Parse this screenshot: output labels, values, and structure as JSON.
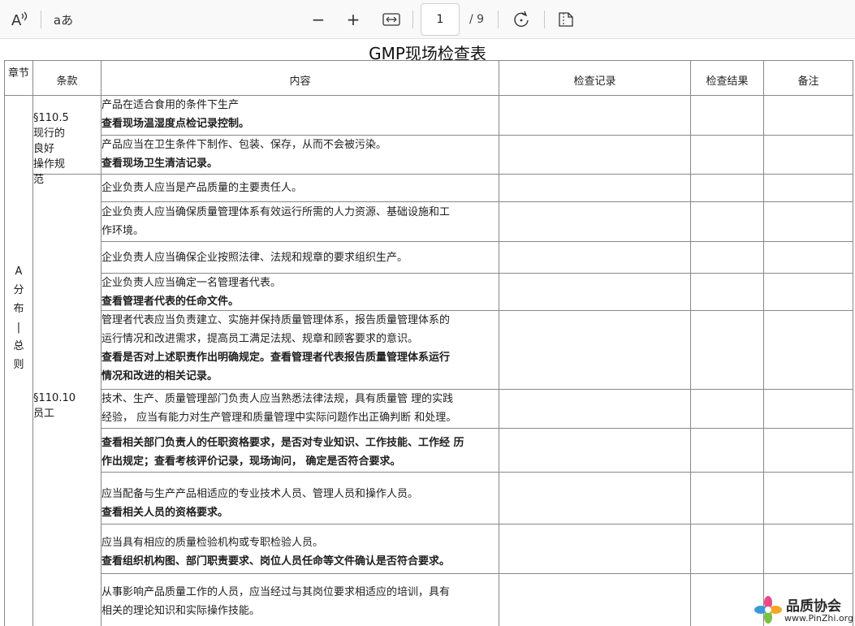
{
  "toolbar": {
    "read_aloud_glyph": "A",
    "text_options_glyph": "aあ",
    "zoom_out": "−",
    "zoom_in": "+",
    "page_current": "1",
    "page_total": "/ 9"
  },
  "document": {
    "title": "GMP现场检查表",
    "headers": {
      "chapter": "章节",
      "clause": "条款",
      "content": "内容",
      "record": "检查记录",
      "result": "检查结果",
      "remark": "备注"
    },
    "chapter_label": [
      "A",
      "分",
      "布",
      "|",
      "总",
      "则"
    ],
    "clauses": {
      "c1": [
        "§110.5",
        "现行的良好",
        "操作规范"
      ],
      "c2": "§110.10员工"
    },
    "rows": [
      {
        "normal": "产品在适合食用的条件下生产",
        "bold": "查看现场温湿度点检记录控制。"
      },
      {
        "normal": "产品应当在卫生条件下制作、包装、保存，从而不会被污染。",
        "bold": "查看现场卫生清洁记录。"
      },
      {
        "normal": "企业负责人应当是产品质量的主要责任人。"
      },
      {
        "normal1": "企业负责人应当确保质量管理体系有效运行所需的人力资源、基础设施和工",
        "normal2": "作环境。"
      },
      {
        "normal": "企业负责人应当确保企业按照法律、法规和规章的要求组织生产。"
      },
      {
        "normal": "企业负责人应当确定一名管理者代表。",
        "bold": "查看管理者代表的任命文件。"
      },
      {
        "normal1": "管理者代表应当负责建立、实施并保持质量管理体系，报告质量管理体系的",
        "normal2": "运行情况和改进需求，提高员工满足法规、规章和顾客要求的意识。",
        "bold1": "查看是否对上述职责作出明确规定。查看管理者代表报告质量管理体系运行",
        "bold2": "情况和改进的相关记录。"
      },
      {
        "normal1": "技术、生产、质量管理部门负责人应当熟悉法律法规，具有质量管  理的实践",
        "normal2": "经验，  应当有能力对生产管理和质量管理中实际问题作出正确判断  和处理。"
      },
      {
        "bold1": "查看相关部门负责人的任职资格要求，是否对专业知识、工作技能、工作经  历",
        "bold2": "作出规定；查看考核评价记录，现场询问，     确定是否符合要求。"
      },
      {
        "normal": "应当配备与生产产品相适应的专业技术人员、管理人员和操作人员。",
        "bold": "查看相关人员的资格要求。"
      },
      {
        "normal": "应当具有相应的质量检验机构或专职检验人员。",
        "bold": "查看组织机构图、部门职责要求、岗位人员任命等文件确认是否符合要求。"
      },
      {
        "normal1": "从事影响产品质量工作的人员，应当经过与其岗位要求相适应的培训，具有",
        "normal2": "相关的理论知识和实际操作技能。"
      }
    ],
    "watermark": {
      "name": "品质协会",
      "url": "www.PinZhi.org"
    }
  }
}
